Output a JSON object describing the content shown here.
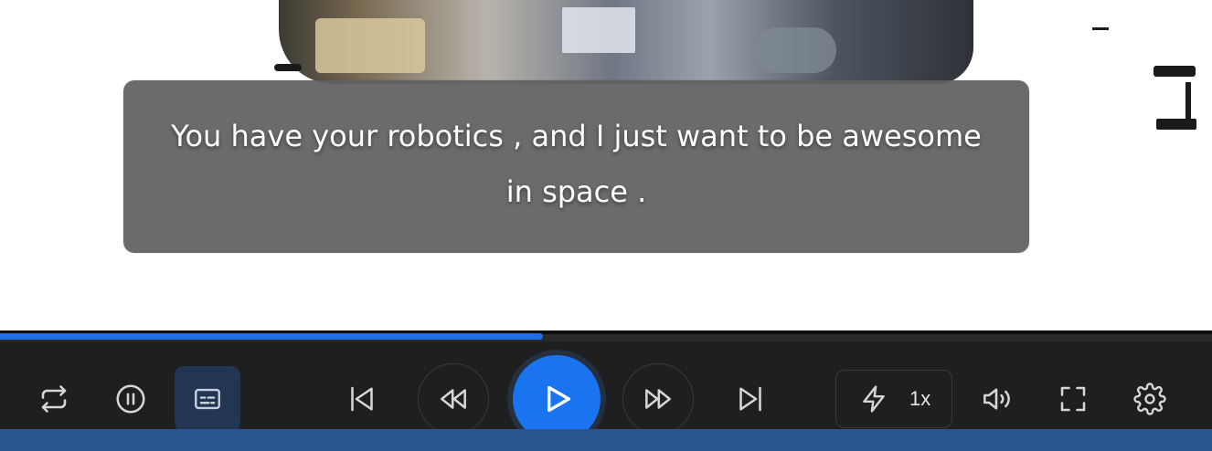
{
  "subtitle": {
    "text": "You have your robotics , and I just want to be awesome in space ."
  },
  "progress": {
    "played_fraction": 0.448
  },
  "controls": {
    "repeat_icon": "repeat-icon",
    "pause_icon": "pause-circle-icon",
    "captions_icon": "captions-icon",
    "skip_previous_icon": "skip-previous-icon",
    "rewind_icon": "rewind-icon",
    "play_icon": "play-icon",
    "fast_forward_icon": "fast-forward-icon",
    "skip_next_icon": "skip-next-icon",
    "speed_icon": "lightning-icon",
    "speed_label": "1x",
    "volume_icon": "volume-icon",
    "fullscreen_icon": "fullscreen-icon",
    "settings_icon": "gear-icon"
  },
  "colors": {
    "accent": "#1a74f0",
    "progress_fill": "#1f6fe5",
    "control_bar_bg": "#1f1f1f",
    "captions_active_bg": "#223552",
    "subtitle_bg": "#606060",
    "bottom_strip": "#2a5590"
  }
}
